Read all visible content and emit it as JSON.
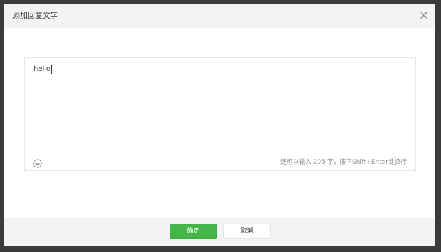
{
  "dialog": {
    "title": "添加回复文字",
    "close_icon": "close-icon"
  },
  "editor": {
    "value": "hello",
    "emoji_icon": "emoji-smiley-icon",
    "counter_text": "还可以输入 295 字，按下Shift+Enter键换行"
  },
  "footer": {
    "confirm_label": "确定",
    "cancel_label": "取消"
  },
  "colors": {
    "primary": "#44b549",
    "header_bg": "#f3f3f5",
    "overlay": "#3b3b3d"
  }
}
